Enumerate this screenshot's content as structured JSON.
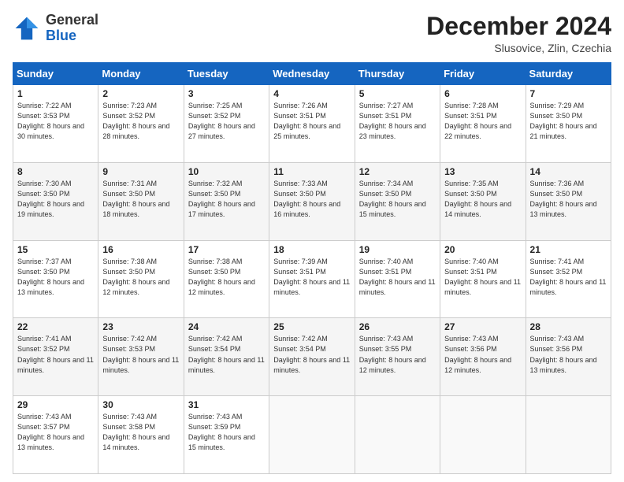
{
  "logo": {
    "line1": "General",
    "line2": "Blue"
  },
  "header": {
    "month": "December 2024",
    "location": "Slusovice, Zlin, Czechia"
  },
  "weekdays": [
    "Sunday",
    "Monday",
    "Tuesday",
    "Wednesday",
    "Thursday",
    "Friday",
    "Saturday"
  ],
  "weeks": [
    [
      {
        "day": "1",
        "sunrise": "Sunrise: 7:22 AM",
        "sunset": "Sunset: 3:53 PM",
        "daylight": "Daylight: 8 hours and 30 minutes."
      },
      {
        "day": "2",
        "sunrise": "Sunrise: 7:23 AM",
        "sunset": "Sunset: 3:52 PM",
        "daylight": "Daylight: 8 hours and 28 minutes."
      },
      {
        "day": "3",
        "sunrise": "Sunrise: 7:25 AM",
        "sunset": "Sunset: 3:52 PM",
        "daylight": "Daylight: 8 hours and 27 minutes."
      },
      {
        "day": "4",
        "sunrise": "Sunrise: 7:26 AM",
        "sunset": "Sunset: 3:51 PM",
        "daylight": "Daylight: 8 hours and 25 minutes."
      },
      {
        "day": "5",
        "sunrise": "Sunrise: 7:27 AM",
        "sunset": "Sunset: 3:51 PM",
        "daylight": "Daylight: 8 hours and 23 minutes."
      },
      {
        "day": "6",
        "sunrise": "Sunrise: 7:28 AM",
        "sunset": "Sunset: 3:51 PM",
        "daylight": "Daylight: 8 hours and 22 minutes."
      },
      {
        "day": "7",
        "sunrise": "Sunrise: 7:29 AM",
        "sunset": "Sunset: 3:50 PM",
        "daylight": "Daylight: 8 hours and 21 minutes."
      }
    ],
    [
      {
        "day": "8",
        "sunrise": "Sunrise: 7:30 AM",
        "sunset": "Sunset: 3:50 PM",
        "daylight": "Daylight: 8 hours and 19 minutes."
      },
      {
        "day": "9",
        "sunrise": "Sunrise: 7:31 AM",
        "sunset": "Sunset: 3:50 PM",
        "daylight": "Daylight: 8 hours and 18 minutes."
      },
      {
        "day": "10",
        "sunrise": "Sunrise: 7:32 AM",
        "sunset": "Sunset: 3:50 PM",
        "daylight": "Daylight: 8 hours and 17 minutes."
      },
      {
        "day": "11",
        "sunrise": "Sunrise: 7:33 AM",
        "sunset": "Sunset: 3:50 PM",
        "daylight": "Daylight: 8 hours and 16 minutes."
      },
      {
        "day": "12",
        "sunrise": "Sunrise: 7:34 AM",
        "sunset": "Sunset: 3:50 PM",
        "daylight": "Daylight: 8 hours and 15 minutes."
      },
      {
        "day": "13",
        "sunrise": "Sunrise: 7:35 AM",
        "sunset": "Sunset: 3:50 PM",
        "daylight": "Daylight: 8 hours and 14 minutes."
      },
      {
        "day": "14",
        "sunrise": "Sunrise: 7:36 AM",
        "sunset": "Sunset: 3:50 PM",
        "daylight": "Daylight: 8 hours and 13 minutes."
      }
    ],
    [
      {
        "day": "15",
        "sunrise": "Sunrise: 7:37 AM",
        "sunset": "Sunset: 3:50 PM",
        "daylight": "Daylight: 8 hours and 13 minutes."
      },
      {
        "day": "16",
        "sunrise": "Sunrise: 7:38 AM",
        "sunset": "Sunset: 3:50 PM",
        "daylight": "Daylight: 8 hours and 12 minutes."
      },
      {
        "day": "17",
        "sunrise": "Sunrise: 7:38 AM",
        "sunset": "Sunset: 3:50 PM",
        "daylight": "Daylight: 8 hours and 12 minutes."
      },
      {
        "day": "18",
        "sunrise": "Sunrise: 7:39 AM",
        "sunset": "Sunset: 3:51 PM",
        "daylight": "Daylight: 8 hours and 11 minutes."
      },
      {
        "day": "19",
        "sunrise": "Sunrise: 7:40 AM",
        "sunset": "Sunset: 3:51 PM",
        "daylight": "Daylight: 8 hours and 11 minutes."
      },
      {
        "day": "20",
        "sunrise": "Sunrise: 7:40 AM",
        "sunset": "Sunset: 3:51 PM",
        "daylight": "Daylight: 8 hours and 11 minutes."
      },
      {
        "day": "21",
        "sunrise": "Sunrise: 7:41 AM",
        "sunset": "Sunset: 3:52 PM",
        "daylight": "Daylight: 8 hours and 11 minutes."
      }
    ],
    [
      {
        "day": "22",
        "sunrise": "Sunrise: 7:41 AM",
        "sunset": "Sunset: 3:52 PM",
        "daylight": "Daylight: 8 hours and 11 minutes."
      },
      {
        "day": "23",
        "sunrise": "Sunrise: 7:42 AM",
        "sunset": "Sunset: 3:53 PM",
        "daylight": "Daylight: 8 hours and 11 minutes."
      },
      {
        "day": "24",
        "sunrise": "Sunrise: 7:42 AM",
        "sunset": "Sunset: 3:54 PM",
        "daylight": "Daylight: 8 hours and 11 minutes."
      },
      {
        "day": "25",
        "sunrise": "Sunrise: 7:42 AM",
        "sunset": "Sunset: 3:54 PM",
        "daylight": "Daylight: 8 hours and 11 minutes."
      },
      {
        "day": "26",
        "sunrise": "Sunrise: 7:43 AM",
        "sunset": "Sunset: 3:55 PM",
        "daylight": "Daylight: 8 hours and 12 minutes."
      },
      {
        "day": "27",
        "sunrise": "Sunrise: 7:43 AM",
        "sunset": "Sunset: 3:56 PM",
        "daylight": "Daylight: 8 hours and 12 minutes."
      },
      {
        "day": "28",
        "sunrise": "Sunrise: 7:43 AM",
        "sunset": "Sunset: 3:56 PM",
        "daylight": "Daylight: 8 hours and 13 minutes."
      }
    ],
    [
      {
        "day": "29",
        "sunrise": "Sunrise: 7:43 AM",
        "sunset": "Sunset: 3:57 PM",
        "daylight": "Daylight: 8 hours and 13 minutes."
      },
      {
        "day": "30",
        "sunrise": "Sunrise: 7:43 AM",
        "sunset": "Sunset: 3:58 PM",
        "daylight": "Daylight: 8 hours and 14 minutes."
      },
      {
        "day": "31",
        "sunrise": "Sunrise: 7:43 AM",
        "sunset": "Sunset: 3:59 PM",
        "daylight": "Daylight: 8 hours and 15 minutes."
      },
      null,
      null,
      null,
      null
    ]
  ]
}
